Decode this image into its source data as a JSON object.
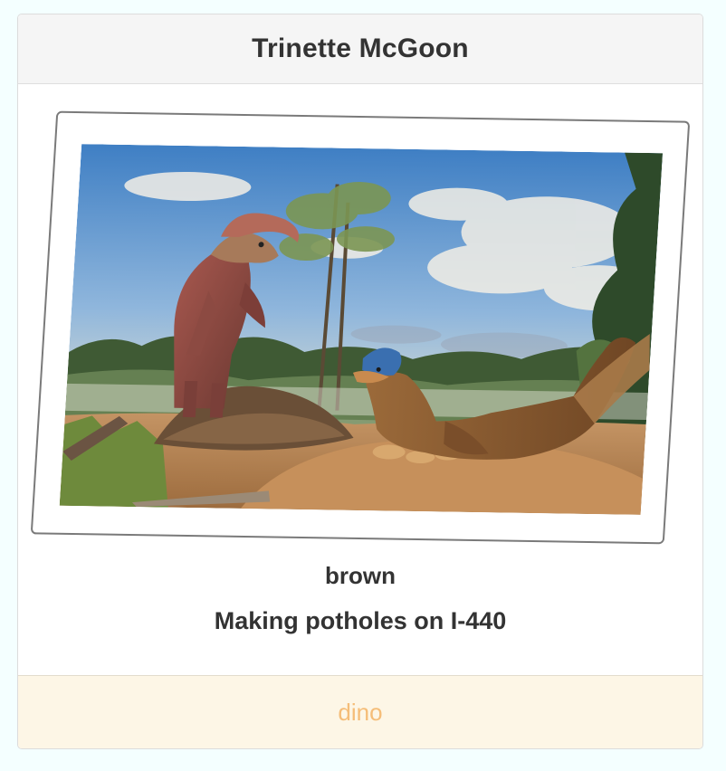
{
  "card": {
    "name": "Trinette McGoon",
    "color": "brown",
    "description": "Making potholes on I-440",
    "footer_label": "dino"
  },
  "image": {
    "subject": "dinosaur-nesting-illustration",
    "colors": {
      "sky_top": "#4a86c8",
      "sky_bottom": "#dfe7df",
      "ground": "#b98a5a",
      "dino_brown": "#8a5a2e",
      "dino_red": "#9b4a44",
      "crest_blue": "#3a6fb0"
    }
  }
}
